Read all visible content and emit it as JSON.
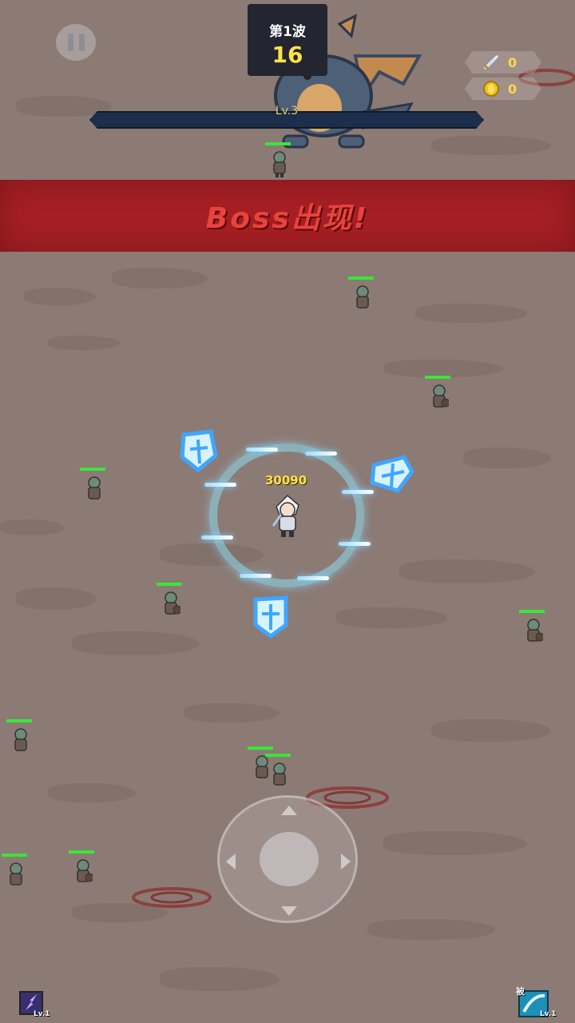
{
  "hud": {
    "wave_label": "第1波",
    "wave_count": "16",
    "sword_count": "0",
    "coin_count": "0",
    "level_label": "Lv.3",
    "xp_progress": 0
  },
  "banner": {
    "text": "Boss出现!"
  },
  "hero": {
    "damage_text": "30090"
  },
  "skills": {
    "left_level": "Lv.1",
    "right_tag": "被",
    "right_level": "Lv.1"
  },
  "colors": {
    "ground": "#8c7a74",
    "banner": "#a61f24",
    "banner_text": "#e8443c",
    "hp_bar": "#39e639",
    "gold": "#ffe24a"
  },
  "icons": [
    "pause-icon",
    "sword-icon",
    "coin-icon",
    "dragon-boss",
    "goblin-enemy",
    "hero-knight",
    "blue-shield",
    "light-sword",
    "joystick"
  ]
}
